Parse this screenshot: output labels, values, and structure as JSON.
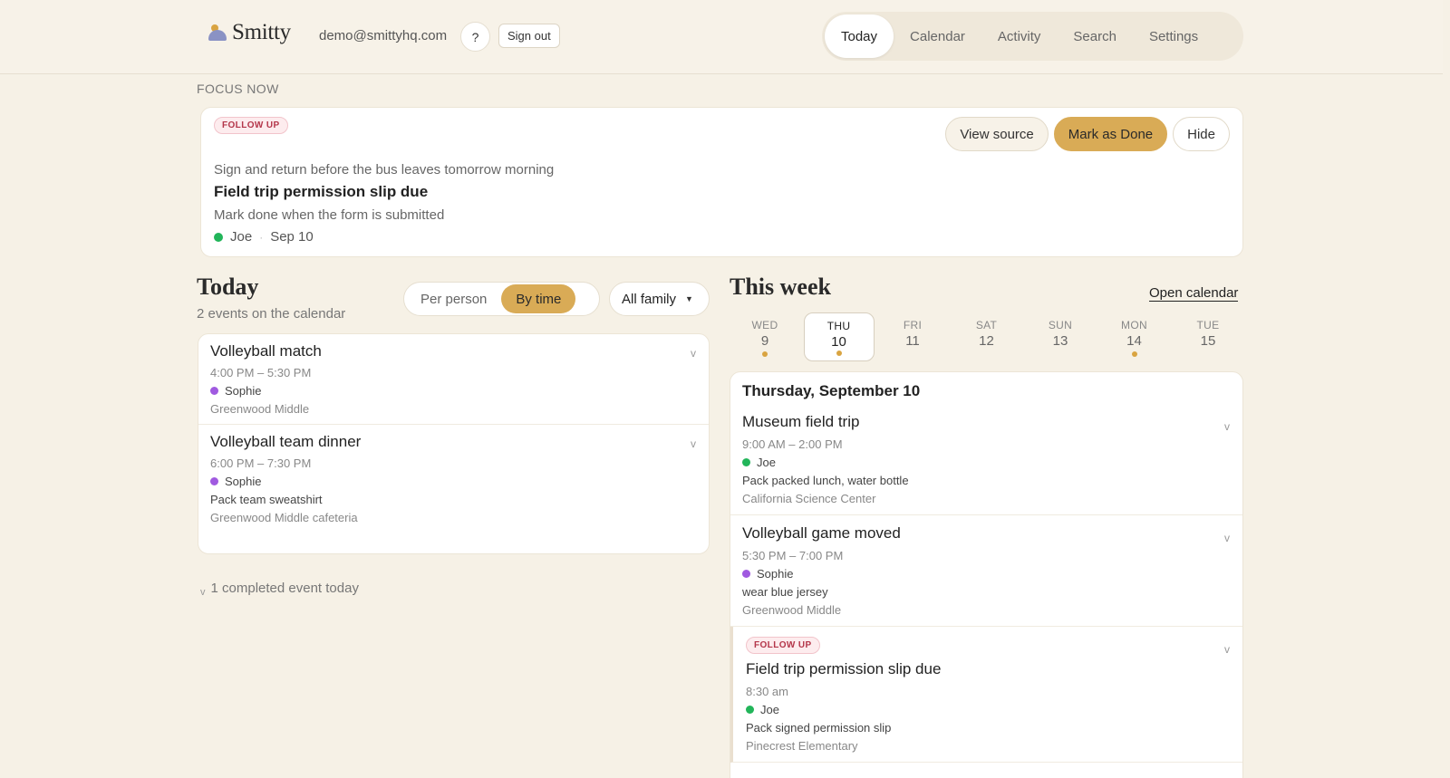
{
  "app": {
    "logo_text": "Smitty",
    "user_email": "demo@smittyhq.com",
    "help_label": "?",
    "signout_label": "Sign out"
  },
  "nav": {
    "tabs": [
      {
        "label": "Today",
        "active": true
      },
      {
        "label": "Calendar",
        "active": false
      },
      {
        "label": "Activity",
        "active": false
      },
      {
        "label": "Search",
        "active": false
      },
      {
        "label": "Settings",
        "active": false
      }
    ]
  },
  "focus": {
    "section_label": "FOCUS NOW",
    "badge": "FOLLOW UP",
    "subtitle": "Sign and return before the bus leaves tomorrow morning",
    "title": "Field trip permission slip due",
    "note": "Mark done when the form is submitted",
    "person": "Joe",
    "date": "Sep 10",
    "actions": {
      "view_source": "View source",
      "mark_done": "Mark as Done",
      "hide": "Hide"
    }
  },
  "today": {
    "title": "Today",
    "subtitle": "2 events on the calendar",
    "view_toggle": {
      "per_person": "Per person",
      "by_time": "By time"
    },
    "family_filter": "All family",
    "events": [
      {
        "title": "Volleyball match",
        "time": "4:00 PM – 5:30 PM",
        "person": "Sophie",
        "note": "",
        "location": "Greenwood Middle"
      },
      {
        "title": "Volleyball team dinner",
        "time": "6:00 PM – 7:30 PM",
        "person": "Sophie",
        "note": "Pack team sweatshirt",
        "location": "Greenwood Middle cafeteria"
      }
    ],
    "completed_label": "1 completed event today"
  },
  "week": {
    "title": "This week",
    "open_calendar": "Open calendar",
    "days": [
      {
        "name": "WED",
        "num": "9",
        "has_dot": true,
        "active": false
      },
      {
        "name": "THU",
        "num": "10",
        "has_dot": true,
        "active": true
      },
      {
        "name": "FRI",
        "num": "11",
        "has_dot": false,
        "active": false
      },
      {
        "name": "SAT",
        "num": "12",
        "has_dot": false,
        "active": false
      },
      {
        "name": "SUN",
        "num": "13",
        "has_dot": false,
        "active": false
      },
      {
        "name": "MON",
        "num": "14",
        "has_dot": true,
        "active": false
      },
      {
        "name": "TUE",
        "num": "15",
        "has_dot": false,
        "active": false
      }
    ],
    "selected_date": "Thursday, September 10",
    "events": [
      {
        "badge": "",
        "title": "Museum field trip",
        "time": "9:00 AM – 2:00 PM",
        "person": "Joe",
        "note": "Pack packed lunch, water bottle",
        "location": "California Science Center"
      },
      {
        "badge": "",
        "title": "Volleyball game moved",
        "time": "5:30 PM – 7:00 PM",
        "person": "Sophie",
        "note": "wear blue jersey",
        "location": "Greenwood Middle"
      },
      {
        "badge": "FOLLOW UP",
        "title": "Field trip permission slip due",
        "time": "8:30 am",
        "person": "Joe",
        "note": "Pack signed permission slip",
        "location": "Pinecrest Elementary"
      }
    ]
  },
  "colors": {
    "background": "#f6f1e6",
    "accent": "#d9ab56",
    "joe": "#22b55a",
    "sophie": "#a05ae0",
    "followup": "#b4364a"
  },
  "icons": {
    "chevron": "chevron-down-icon",
    "caret": "caret-down-icon",
    "person_dot": "person-color-dot"
  }
}
